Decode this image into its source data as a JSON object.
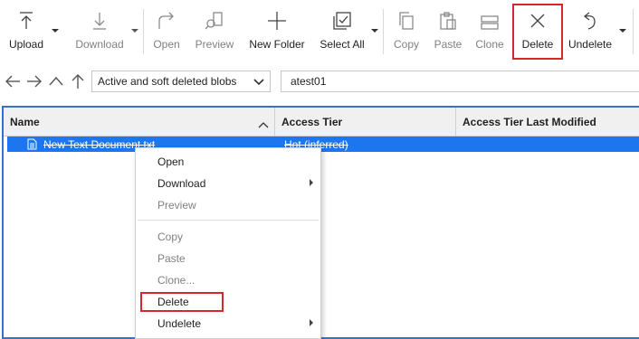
{
  "toolbar": {
    "upload": "Upload",
    "download": "Download",
    "open": "Open",
    "preview": "Preview",
    "new_folder": "New Folder",
    "select_all": "Select All",
    "copy": "Copy",
    "paste": "Paste",
    "clone": "Clone",
    "delete": "Delete",
    "undelete": "Undelete"
  },
  "nav": {
    "view_filter": "Active and soft deleted blobs",
    "path": "atest01"
  },
  "grid": {
    "columns": [
      "Name",
      "Access Tier",
      "Access Tier Last Modified"
    ],
    "rows": [
      {
        "name": "New Text Document.txt",
        "access_tier": "Hot (inferred)",
        "last_modified": ""
      }
    ]
  },
  "context_menu": {
    "items": [
      "Open",
      "Download",
      "Preview",
      "Copy",
      "Paste",
      "Clone...",
      "Delete",
      "Undelete"
    ]
  },
  "colors": {
    "selection": "#1c76f0",
    "highlight": "#d9262c"
  }
}
